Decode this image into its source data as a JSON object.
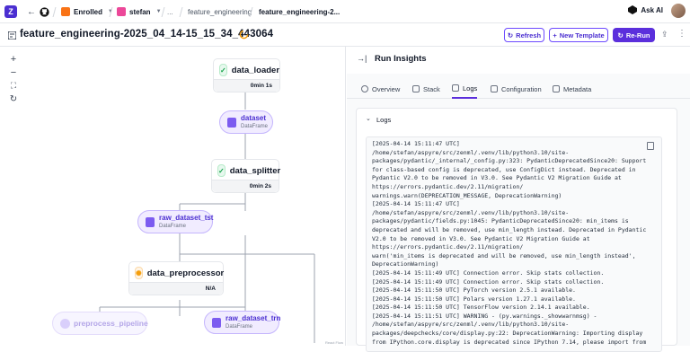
{
  "topbar": {
    "logo": "Z",
    "back_icon": "←",
    "forward_icon": "→",
    "workspace_initial": "",
    "workspace_label": "Enrolled",
    "project_label": "stefan",
    "ellipsis": "...",
    "pipeline_label": "feature_engineering",
    "run_label": "feature_engineering-2...",
    "ask_ai": "Ask AI"
  },
  "header": {
    "title": "feature_engineering-2025_04_14-15_15_34_443064",
    "status_icon": "running-icon",
    "refresh": "Refresh",
    "new_template": "New Template",
    "rerun": "Re-Run",
    "share_icon": "⇪",
    "more_icon": "⋮"
  },
  "canvas": {
    "zoom_in": "+",
    "zoom_out": "−",
    "fit": "⛶",
    "reset": "↻",
    "steps": [
      {
        "name": "data_loader",
        "duration": "0min 1s"
      },
      {
        "name": "data_splitter",
        "duration": "0min 2s"
      },
      {
        "name": "data_preprocessor",
        "duration": "N/A"
      }
    ],
    "artifacts": [
      {
        "name": "dataset",
        "type": "DataFrame"
      },
      {
        "name": "raw_dataset_tst",
        "type": "DataFrame"
      },
      {
        "name": "raw_dataset_trn",
        "type": "DataFrame"
      }
    ],
    "pending_step": "preprocess_pipeline",
    "attribution": "React Flow"
  },
  "panel": {
    "title": "Run Insights",
    "collapse_icon": "→|",
    "tabs": [
      "Overview",
      "Stack",
      "Logs",
      "Configuration",
      "Metadata"
    ],
    "active_tab": "Logs",
    "section_title": "Logs",
    "log_lines": [
      "[2025-04-14 15:11:47 UTC]",
      "/home/stefan/aspyre/src/zenml/.venv/lib/python3.10/site-",
      "packages/pydantic/_internal/_config.py:323: PydanticDeprecatedSince20: Support",
      "for class-based config is deprecated, use ConfigDict instead. Deprecated in",
      "Pydantic V2.0 to be removed in V3.0. See Pydantic V2 Migration Guide at",
      "https://errors.pydantic.dev/2.11/migration/",
      "warnings.warn(DEPRECATION_MESSAGE, DeprecationWarning)",
      "[2025-04-14 15:11:47 UTC]",
      "/home/stefan/aspyre/src/zenml/.venv/lib/python3.10/site-",
      "packages/pydantic/fields.py:1045: PydanticDeprecatedSince20: min_items is",
      "deprecated and will be removed, use min_length instead. Deprecated in Pydantic",
      "V2.0 to be removed in V3.0. See Pydantic V2 Migration Guide at",
      "https://errors.pydantic.dev/2.11/migration/",
      "warn('min_items is deprecated and will be removed, use min_length instead',",
      "DeprecationWarning)",
      "[2025-04-14 15:11:49 UTC] Connection error. Skip stats collection.",
      "[2025-04-14 15:11:49 UTC] Connection error. Skip stats collection.",
      "[2025-04-14 15:11:50 UTC] PyTorch version 2.5.1 available.",
      "[2025-04-14 15:11:50 UTC] Polars version 1.27.1 available.",
      "[2025-04-14 15:11:50 UTC] TensorFlow version 2.14.1 available.",
      "[2025-04-14 15:11:51 UTC] WARNING - (py.warnings._showwarnmsg) -",
      "/home/stefan/aspyre/src/zenml/.venv/lib/python3.10/site-",
      "packages/deepchecks/core/display.py:22: DeprecationWarning: Importing display",
      "from IPython.core.display is deprecated since IPython 7.14, please import from"
    ]
  }
}
